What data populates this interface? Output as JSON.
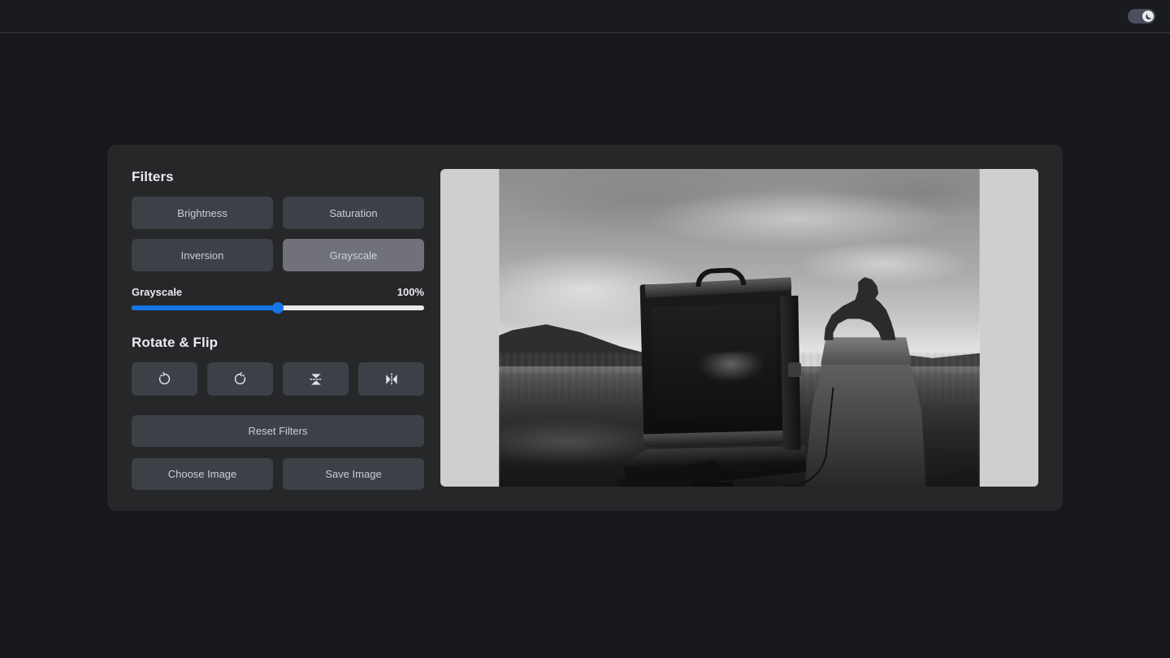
{
  "header": {
    "theme_toggle": {
      "name": "dark-mode-toggle",
      "state": "on",
      "icon": "moon-icon"
    }
  },
  "panel": {
    "filters": {
      "title": "Filters",
      "buttons": [
        {
          "label": "Brightness",
          "active": false
        },
        {
          "label": "Saturation",
          "active": false
        },
        {
          "label": "Inversion",
          "active": false
        },
        {
          "label": "Grayscale",
          "active": true
        }
      ],
      "slider": {
        "label": "Grayscale",
        "value_text": "100%",
        "value": 100,
        "min": 0,
        "max": 200,
        "fill_percent": 50
      }
    },
    "rotate_flip": {
      "title": "Rotate & Flip",
      "buttons": [
        {
          "icon": "rotate-clockwise-icon"
        },
        {
          "icon": "rotate-counterclockwise-icon"
        },
        {
          "icon": "flip-vertical-icon"
        },
        {
          "icon": "flip-horizontal-icon"
        }
      ]
    },
    "actions": {
      "reset_label": "Reset Filters",
      "choose_label": "Choose Image",
      "save_label": "Save Image"
    },
    "preview": {
      "alt": "black and white photo of a large format view camera facing a lion statue on a stone pedestal",
      "filter_applied": "grayscale(100%)"
    }
  },
  "colors": {
    "page_background": "#17181b",
    "header_background": "#1a1b1e",
    "panel_background": "#262729",
    "button_inactive": "#3e4047",
    "button_active": "#717279",
    "button_text": "#c6cedb",
    "heading_text": "#e9ebef",
    "accent_blue": "#1575e6",
    "slider_track": "#e9e9e9",
    "preview_background": "#cfcfcf",
    "toggle_track": "#4a4f5e",
    "toggle_knob": "#e9eaec"
  }
}
